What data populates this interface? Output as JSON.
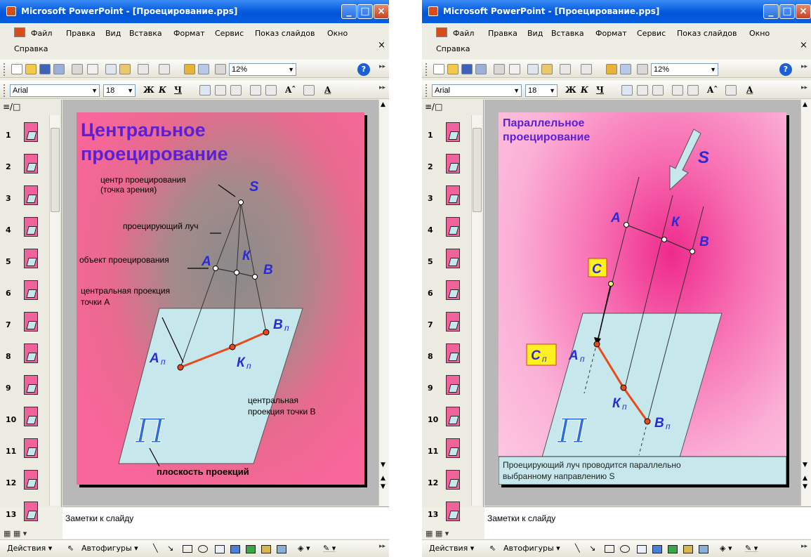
{
  "windows": {
    "left": {
      "title": "Microsoft PowerPoint - [Проецирование.pps]"
    },
    "right": {
      "title": "Microsoft PowerPoint - [Проецирование.pps]"
    }
  },
  "menu": {
    "items": [
      "Файл",
      "Правка",
      "Вид",
      "Вставка",
      "Формат",
      "Сервис",
      "Показ слайдов",
      "Окно",
      "Справка"
    ],
    "close_glyph": "×"
  },
  "toolbar": {
    "zoom": "12%",
    "font_name": "Arial",
    "font_size": "18",
    "bold": "Ж",
    "italic": "К",
    "underline": "Ч",
    "grow_font": "Aˆ",
    "font_color": "A"
  },
  "panel": {
    "tabs": "≡/□",
    "thumbnails": [
      "1",
      "2",
      "3",
      "4",
      "5",
      "6",
      "7",
      "8",
      "9",
      "10",
      "11",
      "12",
      "13"
    ]
  },
  "notes": {
    "placeholder": "Заметки к слайду"
  },
  "drawbar": {
    "actions_label": "Действия ▾",
    "autoshapes_label": "Автофигуры ▾"
  },
  "slide_left": {
    "title_line1": "Центральное",
    "title_line2": "проецирование",
    "label_center": "центр проецирования",
    "label_center2": "(точка зрения)",
    "label_ray": "проецирующий луч",
    "label_object": "объект проецирования",
    "label_proj_a1": "центральная проекция",
    "label_proj_a2": "точки А",
    "label_proj_b1": "центральная",
    "label_proj_b2": "проекция точки В",
    "label_plane": "плоскость проекций",
    "point_s": "S",
    "point_a": "A",
    "point_k": "К",
    "point_b": "В",
    "point_an": "A",
    "point_kn": "К",
    "point_bn": "В",
    "sub_p": "п",
    "plane_symbol": "П"
  },
  "slide_right": {
    "title_line1": "Параллельное",
    "title_line2": "проецирование",
    "point_s": "S",
    "point_a": "A",
    "point_k": "К",
    "point_b": "В",
    "point_c": "С",
    "point_cn": "С",
    "point_an": "A",
    "point_kn": "К",
    "point_bn": "В",
    "sub_p": "п",
    "plane_symbol": "П",
    "caption_line1": "Проецирующий луч проводится параллельно",
    "caption_line2": "выбранному направлению S"
  },
  "colors": {
    "slide_title_left": "#5b1fd6",
    "slide_title_right": "#5b1fd6",
    "point_label": "#2a2ad8",
    "projection_segment": "#e84a1a",
    "plane_fill": "#c6e8ec"
  }
}
